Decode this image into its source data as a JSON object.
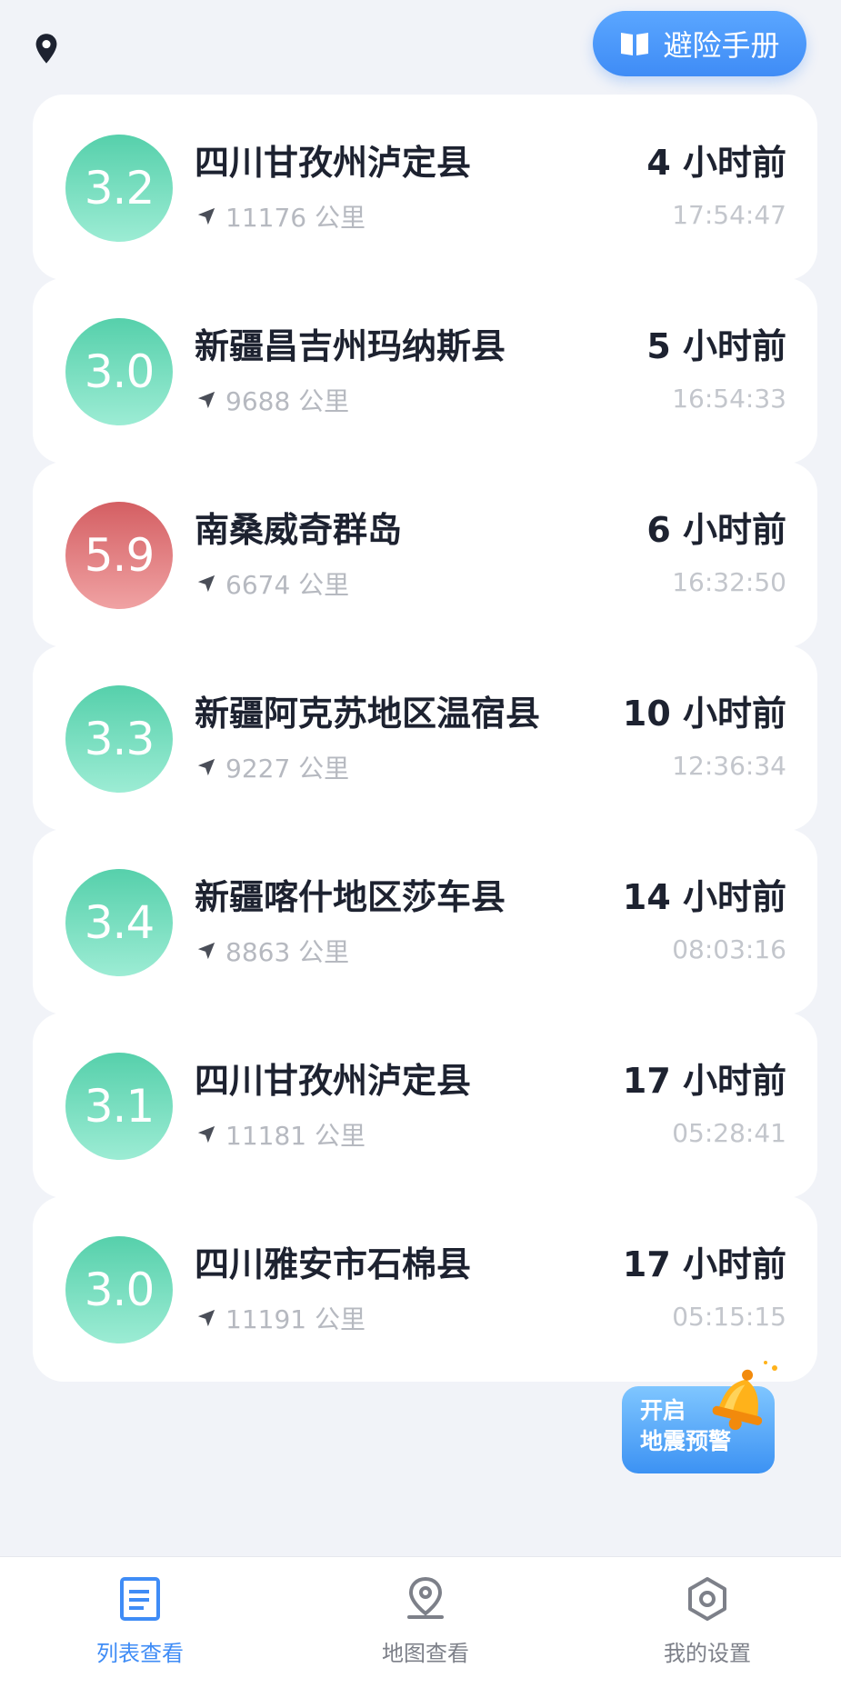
{
  "header": {
    "location_icon": "location-pin-icon",
    "guide_button_label": "避险手册",
    "guide_button_icon": "open-book-icon"
  },
  "earthquakes": [
    {
      "magnitude": "3.2",
      "place": "四川甘孜州泸定县",
      "distance": "11176 公里",
      "ago": "4 小时前",
      "time": "17:54:47",
      "level": "green"
    },
    {
      "magnitude": "3.0",
      "place": "新疆昌吉州玛纳斯县",
      "distance": "9688 公里",
      "ago": "5 小时前",
      "time": "16:54:33",
      "level": "green"
    },
    {
      "magnitude": "5.9",
      "place": "南桑威奇群岛",
      "distance": "6674 公里",
      "ago": "6 小时前",
      "time": "16:32:50",
      "level": "red"
    },
    {
      "magnitude": "3.3",
      "place": "新疆阿克苏地区温宿县",
      "distance": "9227 公里",
      "ago": "10 小时前",
      "time": "12:36:34",
      "level": "green"
    },
    {
      "magnitude": "3.4",
      "place": "新疆喀什地区莎车县",
      "distance": "8863 公里",
      "ago": "14 小时前",
      "time": "08:03:16",
      "level": "green"
    },
    {
      "magnitude": "3.1",
      "place": "四川甘孜州泸定县",
      "distance": "11181 公里",
      "ago": "17 小时前",
      "time": "05:28:41",
      "level": "green"
    },
    {
      "magnitude": "3.0",
      "place": "四川雅安市石棉县",
      "distance": "11191 公里",
      "ago": "17 小时前",
      "time": "05:15:15",
      "level": "green"
    }
  ],
  "alert_fab": {
    "line1": "开启",
    "line2": "地震预警",
    "icon": "bell-icon"
  },
  "bottom_nav": [
    {
      "label": "列表查看",
      "icon": "list-icon",
      "active": true
    },
    {
      "label": "地图查看",
      "icon": "map-pin-icon",
      "active": false
    },
    {
      "label": "我的设置",
      "icon": "settings-hexagon-icon",
      "active": false
    }
  ],
  "colors": {
    "accent": "#3f8cf6",
    "magnitude_green": "#56d0ab",
    "magnitude_red": "#d45f63",
    "background": "#f1f3f8"
  }
}
